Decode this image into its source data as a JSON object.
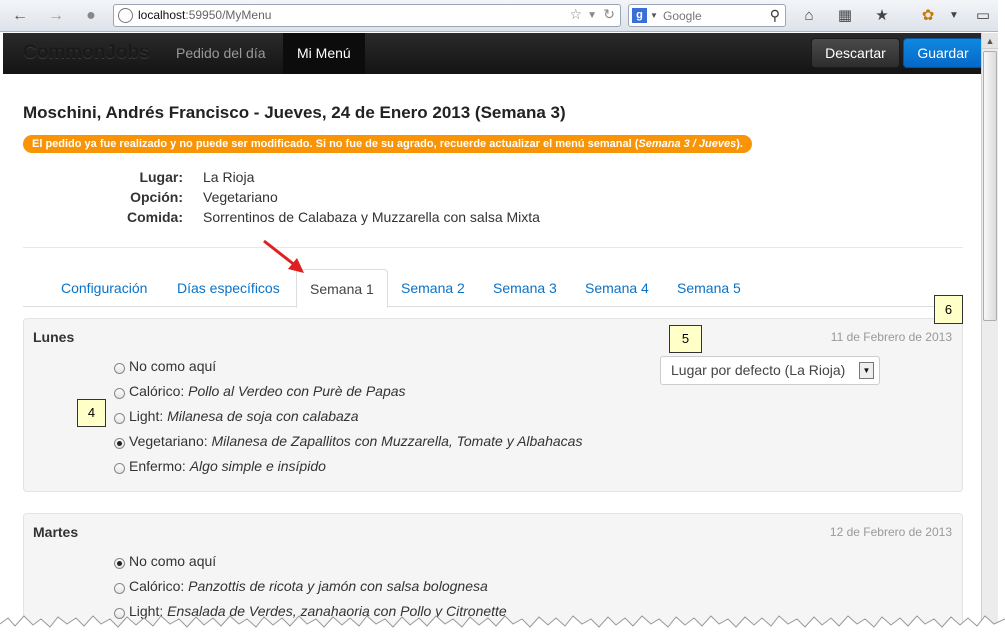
{
  "browser": {
    "url_host": "localhost",
    "url_rest": ":59950/MyMenu",
    "search_placeholder": "Google"
  },
  "navbar": {
    "brand": "CommonJobs",
    "links": [
      "Pedido del día",
      "Mi Menú"
    ],
    "discard_label": "Descartar",
    "save_label": "Guardar"
  },
  "header": {
    "title": "Moschini, Andrés Francisco - Jueves, 24 de Enero 2013 (Semana 3)",
    "warning_text": "El pedido ya fue realizado y no puede ser modificado. Si no fue de su agrado, recuerde actualizar el menú semanal (",
    "warning_link": "Semana 3 / Jueves",
    "warning_end": ")."
  },
  "info": {
    "place_label": "Lugar:",
    "place_value": "La Rioja",
    "option_label": "Opción:",
    "option_value": "Vegetariano",
    "meal_label": "Comida:",
    "meal_value": "Sorrentinos de Calabaza y Muzzarella con salsa Mixta"
  },
  "tabs": [
    "Configuración",
    "Días específicos",
    "Semana 1",
    "Semana 2",
    "Semana 3",
    "Semana 4",
    "Semana 5"
  ],
  "days": [
    {
      "name": "Lunes",
      "date": "11 de Febrero de 2013",
      "place_select": "Lugar por defecto (La Rioja)",
      "options": [
        {
          "label": "No como aquí",
          "dish": ""
        },
        {
          "label": "Calórico: ",
          "dish": "Pollo al Verdeo con Purè de Papas"
        },
        {
          "label": "Light: ",
          "dish": "Milanesa de soja con calabaza"
        },
        {
          "label": "Vegetariano: ",
          "dish": "Milanesa de Zapallitos con Muzzarella, Tomate y Albahacas"
        },
        {
          "label": "Enfermo: ",
          "dish": "Algo simple e insípido"
        }
      ],
      "selected": 3
    },
    {
      "name": "Martes",
      "date": "12 de Febrero de 2013",
      "options": [
        {
          "label": "No como aquí",
          "dish": ""
        },
        {
          "label": "Calórico: ",
          "dish": "Panzottis de ricota y jamón con salsa bolognesa"
        },
        {
          "label": "Light: ",
          "dish": "Ensalada de Verdes, zanahaoria con Pollo y Citronette"
        }
      ],
      "selected": 0
    }
  ],
  "callouts": [
    "4",
    "5",
    "6"
  ]
}
